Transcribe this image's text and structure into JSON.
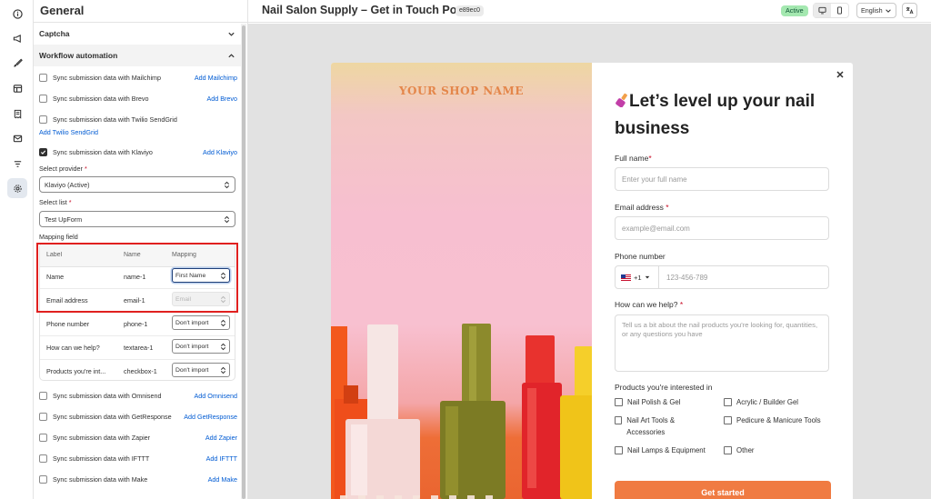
{
  "topbar": {
    "title": "Nail Salon Supply – Get in Touch Popup",
    "id_badge": "e89ec0",
    "status": "Active",
    "language": "English"
  },
  "panel": {
    "title": "General",
    "sections": [
      {
        "label": "Captcha"
      },
      {
        "label": "Workflow automation"
      }
    ],
    "integrations_top": [
      {
        "label": "Sync submission data with Mailchimp",
        "action": "Add Mailchimp",
        "checked": false
      },
      {
        "label": "Sync submission data with Brevo",
        "action": "Add Brevo",
        "checked": false
      },
      {
        "label": "Sync submission data with Twilio SendGrid",
        "action": "Add Twilio SendGrid",
        "checked": false
      },
      {
        "label": "Sync submission data with Klaviyo",
        "action": "Add Klaviyo",
        "checked": true
      }
    ],
    "provider": {
      "label": "Select provider",
      "required": "*",
      "value": "Klaviyo (Active)"
    },
    "list": {
      "label": "Select list",
      "required": "*",
      "value": "Test UpForm"
    },
    "mapping": {
      "label": "Mapping field",
      "headers": [
        "Label",
        "Name",
        "Mapping"
      ],
      "rows": [
        {
          "label": "Name",
          "name": "name-1",
          "mapping": "First Name"
        },
        {
          "label": "Email address",
          "name": "email-1",
          "mapping": "Email"
        },
        {
          "label": "Phone number",
          "name": "phone-1",
          "mapping": "Don't import"
        },
        {
          "label": "How can we help?",
          "name": "textarea-1",
          "mapping": "Don't import"
        },
        {
          "label": "Products you're int...",
          "name": "checkbox-1",
          "mapping": "Don't import"
        }
      ]
    },
    "integrations_bottom": [
      {
        "label": "Sync submission data with Omnisend",
        "action": "Add Omnisend",
        "checked": false
      },
      {
        "label": "Sync submission data with GetResponse",
        "action": "Add GetResponse",
        "checked": false
      },
      {
        "label": "Sync submission data with Zapier",
        "action": "Add Zapier",
        "checked": false
      },
      {
        "label": "Sync submission data with IFTTT",
        "action": "Add IFTTT",
        "checked": false
      },
      {
        "label": "Sync submission data with Make",
        "action": "Add Make",
        "checked": false
      }
    ]
  },
  "popup": {
    "shop_name": "YOUR SHOP NAME",
    "headline": "Let’s level up your nail business",
    "headline_emoji": "nail-polish-icon",
    "fields": {
      "full_name": {
        "label": "Full name",
        "required": "*",
        "placeholder": "Enter your full name"
      },
      "email": {
        "label": "Email address",
        "required": "*",
        "placeholder": "example@email.com"
      },
      "phone": {
        "label": "Phone number",
        "code": "+1",
        "placeholder": "123-456-789"
      },
      "help": {
        "label": "How can we help?",
        "required": "*",
        "placeholder": "Tell us a bit about the nail products you're looking for, quantities, or any questions you have"
      }
    },
    "products": {
      "label": "Products you're interested in",
      "options": [
        "Nail Polish & Gel",
        "Acrylic / Builder Gel",
        "Nail Art Tools & Accessories",
        "Pedicure & Manicure Tools",
        "Nail Lamps & Equipment",
        "Other"
      ]
    },
    "submit": "Get started"
  },
  "colors": {
    "accent": "#f07b42",
    "link": "#005bd3",
    "highlight": "#e0201f",
    "active_badge": "#a4e8b0"
  }
}
